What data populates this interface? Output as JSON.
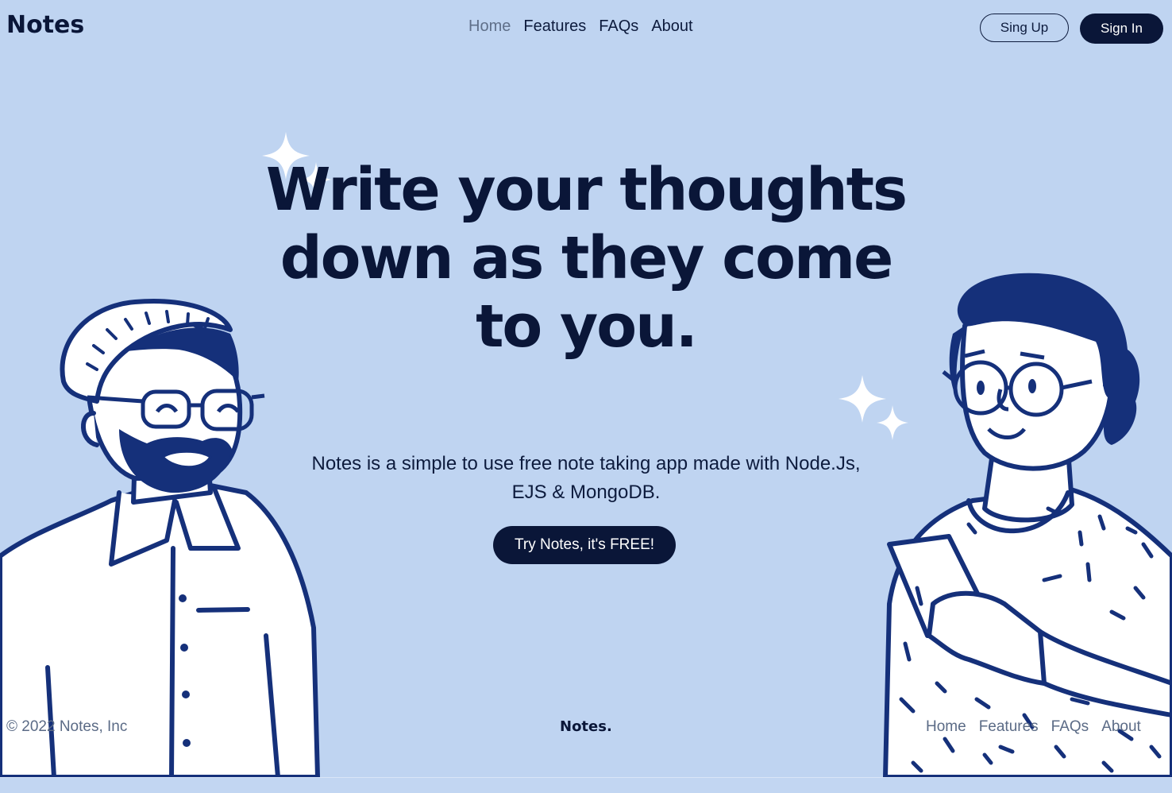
{
  "header": {
    "brand": "Notes",
    "nav": [
      {
        "label": "Home"
      },
      {
        "label": "Features"
      },
      {
        "label": "FAQs"
      },
      {
        "label": "About"
      }
    ],
    "signup_label": "Sing Up",
    "signin_label": "Sign In"
  },
  "hero": {
    "title": "Write your thoughts down as they come to you.",
    "subtitle": "Notes is a simple to use free note taking app made with Node.Js, EJS & MongoDB.",
    "cta_label": "Try Notes, it's FREE!"
  },
  "footer": {
    "copyright": "© 2022 Notes, Inc",
    "brand": "Notes.",
    "nav": [
      {
        "label": "Home"
      },
      {
        "label": "Features"
      },
      {
        "label": "FAQs"
      },
      {
        "label": "About"
      }
    ]
  },
  "colors": {
    "background": "#bfd4f1",
    "primary": "#0a1638",
    "illustration_blue": "#15307a",
    "muted_text": "#5b6b86"
  },
  "icons": [
    "sparkle-icon"
  ]
}
